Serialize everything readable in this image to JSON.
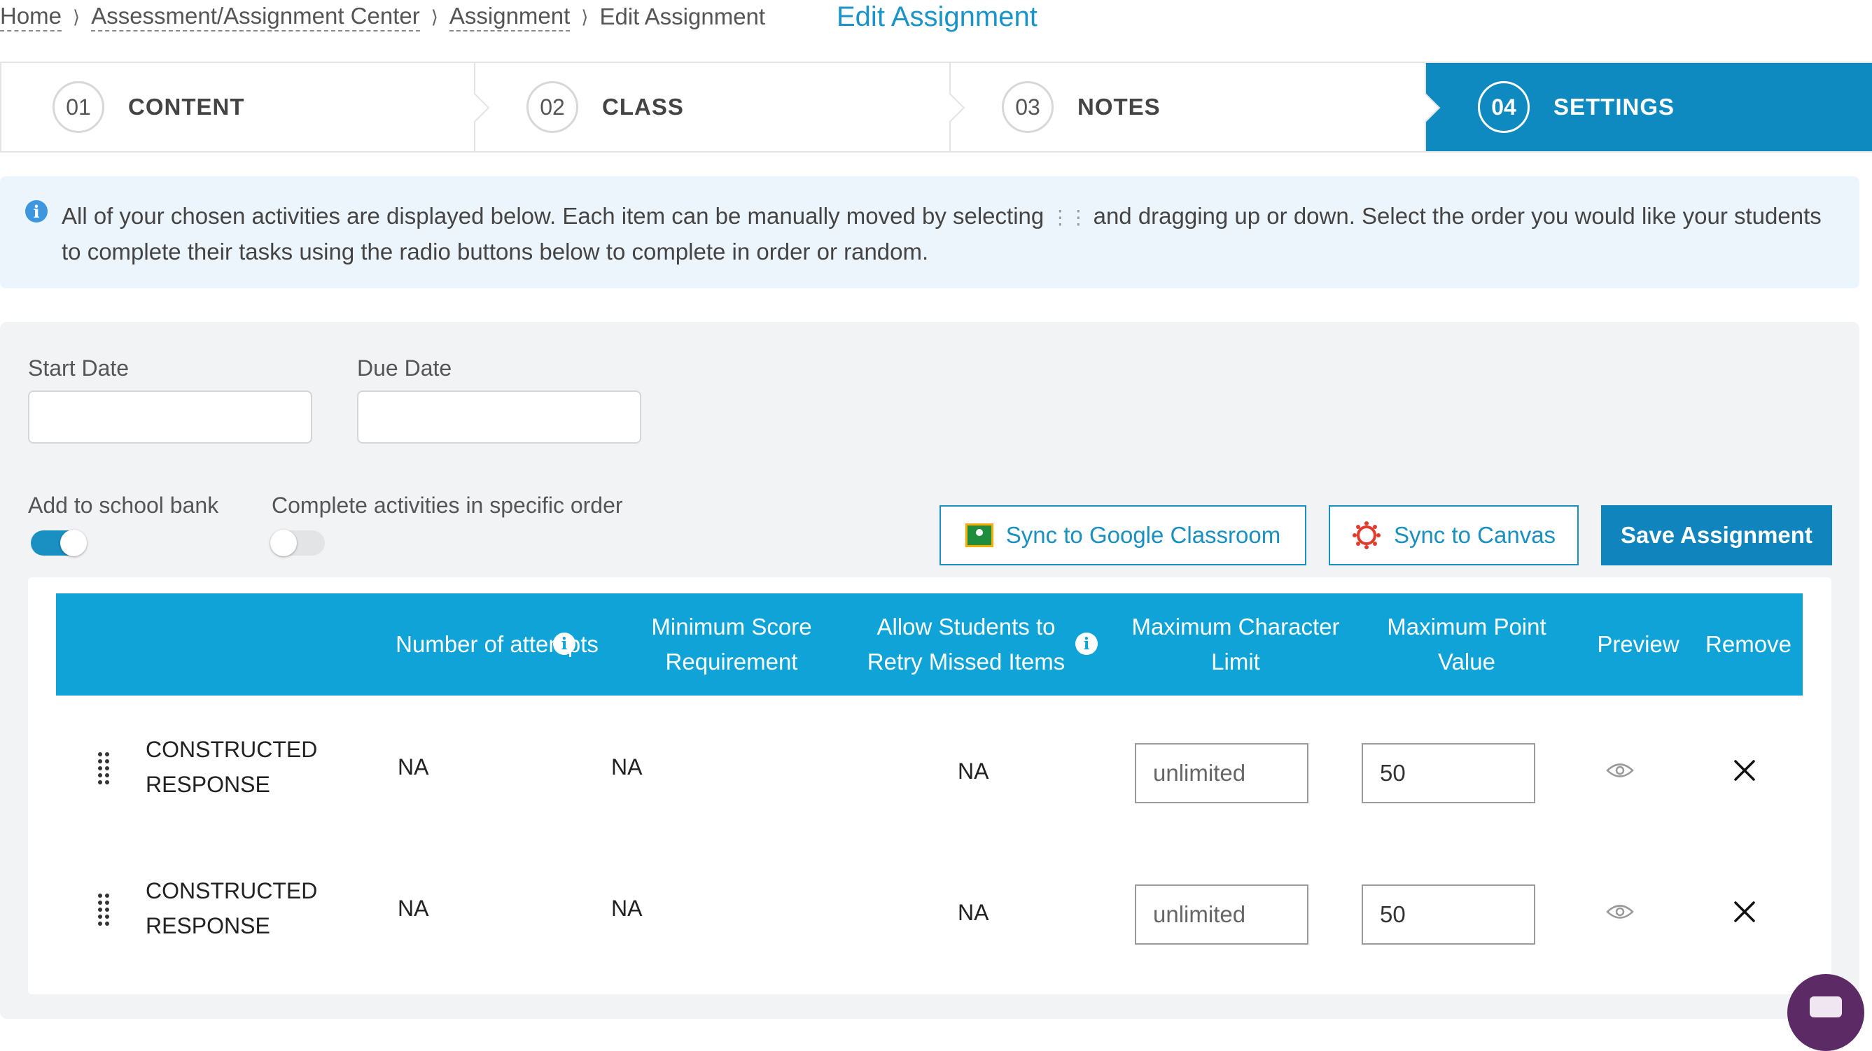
{
  "breadcrumb": {
    "home": "Home",
    "center": "Assessment/Assignment Center",
    "assignment": "Assignment",
    "current": "Edit Assignment",
    "separator": ">"
  },
  "page_title": "Edit Assignment",
  "stepper": [
    {
      "num": "01",
      "label": "CONTENT",
      "active": false
    },
    {
      "num": "02",
      "label": "CLASS",
      "active": false
    },
    {
      "num": "03",
      "label": "NOTES",
      "active": false
    },
    {
      "num": "04",
      "label": "SETTINGS",
      "active": true
    }
  ],
  "info": {
    "text_before": "All of your chosen activities are displayed below. Each item can be manually moved by selecting",
    "text_after": "and dragging up or down. Select the order you would like your students to complete their tasks using the radio buttons below to complete in order or random."
  },
  "settings": {
    "start_date_label": "Start Date",
    "start_date_value": "",
    "due_date_label": "Due Date",
    "due_date_value": "",
    "school_bank_label": "Add to school bank",
    "school_bank_on": true,
    "specific_order_label": "Complete activities in specific order",
    "specific_order_on": false,
    "sync_google_label": "Sync to Google Classroom",
    "sync_canvas_label": "Sync to Canvas",
    "save_label": "Save Assignment"
  },
  "table": {
    "headers": {
      "attempts": "Number of attempts",
      "min_score": "Minimum Score Requirement",
      "retry": "Allow Students to Retry Missed Items",
      "max_char": "Maximum Character Limit",
      "max_point": "Maximum Point Value",
      "preview": "Preview",
      "remove": "Remove"
    },
    "rows": [
      {
        "type": "CONSTRUCTED RESPONSE",
        "attempts": "NA",
        "min_score": "NA",
        "retry": "NA",
        "char_limit_placeholder": "unlimited",
        "char_limit_value": "",
        "point_value": "50"
      },
      {
        "type": "CONSTRUCTED RESPONSE",
        "attempts": "NA",
        "min_score": "NA",
        "retry": "NA",
        "char_limit_placeholder": "unlimited",
        "char_limit_value": "",
        "point_value": "50"
      }
    ]
  },
  "icons": {
    "info": "info-icon",
    "drag": "drag-handle-icon",
    "preview": "eye-icon",
    "remove": "close-icon",
    "google": "google-classroom-icon",
    "canvas": "canvas-icon",
    "chat": "chat-icon"
  },
  "colors": {
    "accent": "#0f8ac0",
    "table_header": "#0fa3d8",
    "info_bg": "#edf5fc",
    "panel_bg": "#f2f3f5"
  }
}
